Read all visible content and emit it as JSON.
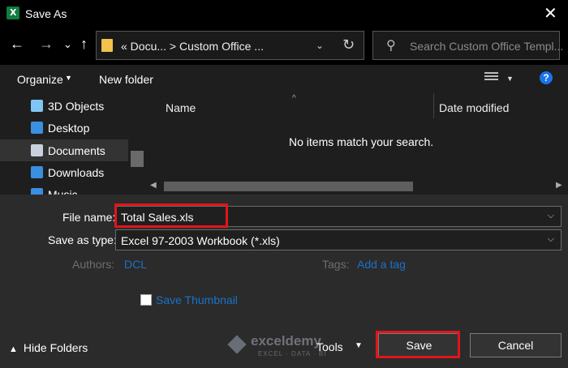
{
  "window": {
    "title": "Save As",
    "close_glyph": "✕"
  },
  "nav": {
    "back": "←",
    "forward": "→",
    "recent": "⌄",
    "up": "↑",
    "address": "«  Docu...  >  Custom Office ...",
    "address_chevron": "⌄",
    "refresh": "↻",
    "search_placeholder": "Search Custom Office Templ..."
  },
  "toolbar": {
    "organize": "Organize",
    "new_folder": "New folder",
    "help": "?"
  },
  "sidebar": {
    "items": [
      {
        "label": "3D Objects",
        "icon": "3d-objects-icon",
        "color": "#7fc6f2"
      },
      {
        "label": "Desktop",
        "icon": "desktop-icon",
        "color": "#3a8fe0"
      },
      {
        "label": "Documents",
        "icon": "documents-icon",
        "color": "#c9d1de",
        "selected": true
      },
      {
        "label": "Downloads",
        "icon": "downloads-icon",
        "color": "#3a8fe0"
      },
      {
        "label": "Music",
        "icon": "music-icon",
        "color": "#3a8fe0"
      }
    ]
  },
  "filelist": {
    "columns": [
      "Name",
      "Date modified"
    ],
    "sort_indicator": "^",
    "empty_message": "No items match your search."
  },
  "form": {
    "file_name_label": "File name:",
    "file_name_value": "Total Sales.xls",
    "save_type_label": "Save as type:",
    "save_type_value": "Excel 97-2003 Workbook (*.xls)",
    "authors_label": "Authors:",
    "authors_value": "DCL",
    "tags_label": "Tags:",
    "tags_value": "Add a tag",
    "thumbnail_label": "Save Thumbnail",
    "thumbnail_checked": false
  },
  "footer": {
    "hide_folders": "Hide Folders",
    "tools": "Tools",
    "save": "Save",
    "cancel": "Cancel"
  },
  "watermark": {
    "name": "exceldemy",
    "tagline": "EXCEL · DATA · BI"
  },
  "colors": {
    "highlight": "#e0141b",
    "link": "#1a73c8",
    "accent": "#1a73e8"
  }
}
